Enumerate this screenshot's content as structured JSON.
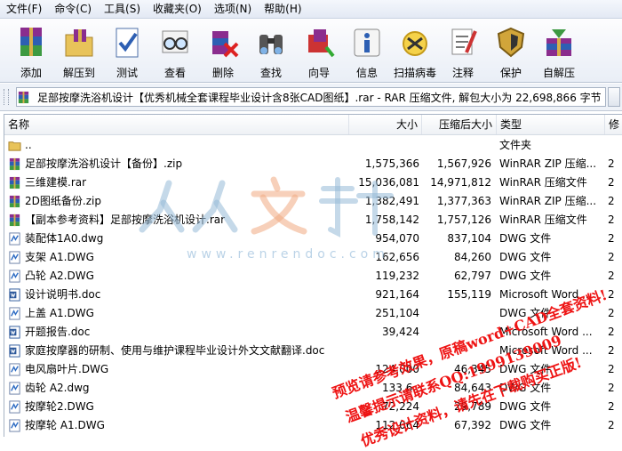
{
  "menu": [
    "文件(F)",
    "命令(C)",
    "工具(S)",
    "收藏夹(O)",
    "选项(N)",
    "帮助(H)"
  ],
  "toolbar": [
    {
      "label": "添加",
      "icon": "archive-stack-icon"
    },
    {
      "label": "解压到",
      "icon": "extract-folder-icon"
    },
    {
      "label": "测试",
      "icon": "test-checklist-icon"
    },
    {
      "label": "查看",
      "icon": "view-glasses-icon"
    },
    {
      "label": "删除",
      "icon": "delete-icon"
    },
    {
      "label": "查找",
      "icon": "binoculars-icon"
    },
    {
      "label": "向导",
      "icon": "wizard-icon"
    },
    {
      "label": "信息",
      "icon": "info-icon"
    },
    {
      "label": "扫描病毒",
      "icon": "virus-scan-icon"
    },
    {
      "label": "注释",
      "icon": "comment-icon"
    },
    {
      "label": "保护",
      "icon": "shield-icon"
    },
    {
      "label": "自解压",
      "icon": "sfx-icon"
    }
  ],
  "address": "足部按摩洗浴机设计【优秀机械全套课程毕业设计含8张CAD图纸】.rar - RAR 压缩文件, 解包大小为 22,698,866 字节",
  "columns": {
    "name": "名称",
    "size": "大小",
    "packed": "压缩后大小",
    "type": "类型"
  },
  "files": [
    {
      "name": "..",
      "size": "",
      "packed": "",
      "type": "文件夹",
      "extra": "",
      "icon": "folder"
    },
    {
      "name": "足部按摩洗浴机设计【备份】.zip",
      "size": "1,575,366",
      "packed": "1,567,926",
      "type": "WinRAR ZIP 压缩...",
      "extra": "2",
      "icon": "rar"
    },
    {
      "name": "三维建模.rar",
      "size": "15,036,081",
      "packed": "14,971,812",
      "type": "WinRAR 压缩文件",
      "extra": "2",
      "icon": "rar"
    },
    {
      "name": "2D图纸备份.zip",
      "size": "1,382,491",
      "packed": "1,377,363",
      "type": "WinRAR ZIP 压缩...",
      "extra": "2",
      "icon": "rar"
    },
    {
      "name": "【副本参考资料】足部按摩洗浴机设计.rar",
      "size": "1,758,142",
      "packed": "1,757,126",
      "type": "WinRAR 压缩文件",
      "extra": "2",
      "icon": "rar"
    },
    {
      "name": "装配体1A0.dwg",
      "size": "954,070",
      "packed": "837,104",
      "type": "DWG 文件",
      "extra": "2",
      "icon": "dwg"
    },
    {
      "name": "支架 A1.DWG",
      "size": "162,656",
      "packed": "84,260",
      "type": "DWG 文件",
      "extra": "2",
      "icon": "dwg"
    },
    {
      "name": "凸轮 A2.DWG",
      "size": "119,232",
      "packed": "62,797",
      "type": "DWG 文件",
      "extra": "2",
      "icon": "dwg"
    },
    {
      "name": "设计说明书.doc",
      "size": "921,164",
      "packed": "155,119",
      "type": "Microsoft Word ...",
      "extra": "2",
      "icon": "doc"
    },
    {
      "name": "上盖 A1.DWG",
      "size": "251,104",
      "packed": "",
      "type": "DWG 文件",
      "extra": "2",
      "icon": "dwg"
    },
    {
      "name": "开题报告.doc",
      "size": "39,424",
      "packed": "",
      "type": "Microsoft Word ...",
      "extra": "2",
      "icon": "doc"
    },
    {
      "name": "家庭按摩器的研制、使用与维护课程毕业设计外文文献翻译.doc",
      "size": "",
      "packed": "",
      "type": "Microsoft Word ...",
      "extra": "2",
      "icon": "doc"
    },
    {
      "name": "电风扇叶片.DWG",
      "size": "124,000",
      "packed": "46,345",
      "type": "DWG 文件",
      "extra": "2",
      "icon": "dwg"
    },
    {
      "name": "齿轮 A2.dwg",
      "size": "133,6..",
      "packed": "84,643",
      "type": "DWG 文件",
      "extra": "2",
      "icon": "dwg"
    },
    {
      "name": "按摩轮2.DWG",
      "size": "72,224",
      "packed": "29,789",
      "type": "DWG 文件",
      "extra": "2",
      "icon": "dwg"
    },
    {
      "name": "按摩轮 A1.DWG",
      "size": "112,064",
      "packed": "67,392",
      "type": "DWG 文件",
      "extra": "2",
      "icon": "dwg"
    }
  ],
  "watermark": {
    "logo": "人人文库",
    "url": "www.renrendoc.com"
  },
  "stamp_lines": [
    "预览请参考效果，原稿word+CAD全套资料!",
    "温馨提示请联系QQ:1999139009",
    "优秀设计资料，请先在下载购买正版!"
  ]
}
